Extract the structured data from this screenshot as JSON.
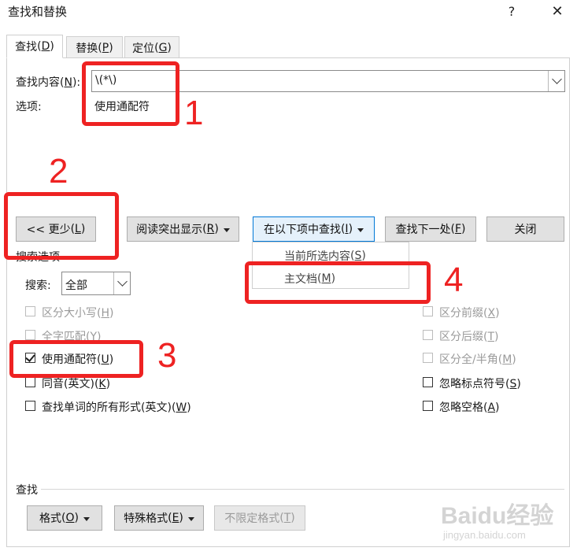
{
  "window": {
    "title": "查找和替换",
    "help_label": "?",
    "close_label": "✕"
  },
  "tabs": [
    {
      "label": "查找",
      "hotkey": "D",
      "active": true
    },
    {
      "label": "替换",
      "hotkey": "P",
      "active": false
    },
    {
      "label": "定位",
      "hotkey": "G",
      "active": false
    }
  ],
  "find": {
    "label": "查找内容",
    "hotkey": "N",
    "value": "\\(*\\)",
    "options_label": "选项:",
    "options_value": "使用通配符"
  },
  "buttons": {
    "less": {
      "label": "<< 更少",
      "hotkey": "L"
    },
    "highlight": {
      "label": "阅读突出显示",
      "hotkey": "R"
    },
    "find_in": {
      "label": "在以下项中查找",
      "hotkey": "I"
    },
    "find_next": {
      "label": "查找下一处",
      "hotkey": "F"
    },
    "close": "关闭"
  },
  "find_in_menu": {
    "items": [
      {
        "label": "当前所选内容",
        "hotkey": "S"
      },
      {
        "label": "主文档",
        "hotkey": "M"
      }
    ]
  },
  "search_options": {
    "section_label": "搜索选项",
    "search_label": "搜索",
    "search_hotkey": "H",
    "search_value": "全部",
    "left": [
      {
        "label": "区分大小写",
        "hotkey": "H",
        "checked": false,
        "enabled": false
      },
      {
        "label": "全字匹配",
        "hotkey": "Y",
        "checked": false,
        "enabled": false
      },
      {
        "label": "使用通配符",
        "hotkey": "U",
        "checked": true,
        "enabled": true
      },
      {
        "label": "同音(英文)",
        "hotkey": "K",
        "checked": false,
        "enabled": true
      },
      {
        "label": "查找单词的所有形式(英文)",
        "hotkey": "W",
        "checked": false,
        "enabled": true
      }
    ],
    "right": [
      {
        "label": "区分前缀",
        "hotkey": "X",
        "checked": false,
        "enabled": false
      },
      {
        "label": "区分后缀",
        "hotkey": "T",
        "checked": false,
        "enabled": false
      },
      {
        "label": "区分全/半角",
        "hotkey": "M",
        "checked": false,
        "enabled": false
      },
      {
        "label": "忽略标点符号",
        "hotkey": "S",
        "checked": false,
        "enabled": true
      },
      {
        "label": "忽略空格",
        "hotkey": "A",
        "checked": false,
        "enabled": true
      }
    ]
  },
  "find_section": {
    "label": "查找",
    "format": {
      "label": "格式",
      "hotkey": "O"
    },
    "special": {
      "label": "特殊格式",
      "hotkey": "E"
    },
    "no_format": {
      "label": "不限定格式",
      "hotkey": "T"
    }
  },
  "annotations": [
    "1",
    "2",
    "3",
    "4"
  ],
  "watermark": {
    "brand": "Baidu经验",
    "url": "jingyan.baidu.com"
  },
  "colors": {
    "annotation_red": "#ee2222",
    "accent_blue": "#0078d7"
  }
}
